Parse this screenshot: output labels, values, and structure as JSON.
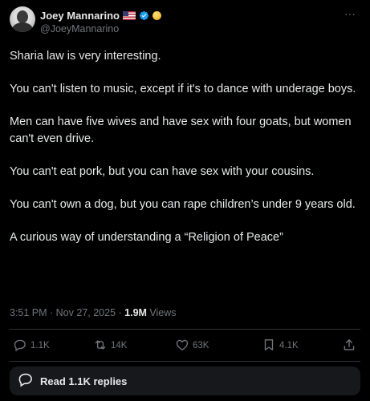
{
  "author": {
    "display_name": "Joey Mannarino",
    "handle": "@JoeyMannarino",
    "badges": [
      "us-flag-icon",
      "verified-icon",
      "coin-icon"
    ],
    "verified_color": "#1d9bf0"
  },
  "post": {
    "paragraphs": [
      "Sharia law is very interesting.",
      "You can't listen to music, except if it's to dance with underage boys.",
      "Men can have five wives and have sex with four goats, but women can't even drive.",
      "You can't eat pork, but you can have sex with your cousins.",
      "You can't own a dog, but you can rape children’s under 9 years old.",
      "A curious way of understanding a “Religion of Peace”"
    ],
    "timestamp": "3:51 PM · Nov 27, 2025 · ",
    "views_count": "1.9M",
    "views_label": " Views"
  },
  "actions": {
    "reply": {
      "icon": "reply-icon",
      "count": "1.1K"
    },
    "repost": {
      "icon": "repost-icon",
      "count": "14K"
    },
    "like": {
      "icon": "heart-icon",
      "count": "63K"
    },
    "bookmark": {
      "icon": "bookmark-icon",
      "count": "4.1K"
    },
    "share": {
      "icon": "share-icon"
    }
  },
  "replies_button": {
    "icon": "speech-bubble-icon",
    "label": "Read 1.1K replies"
  },
  "theme": {
    "background": "#000000",
    "text": "#e7e9ea",
    "secondary_text": "#71767b",
    "divider": "#2f3336",
    "button_bg": "#16181c"
  }
}
